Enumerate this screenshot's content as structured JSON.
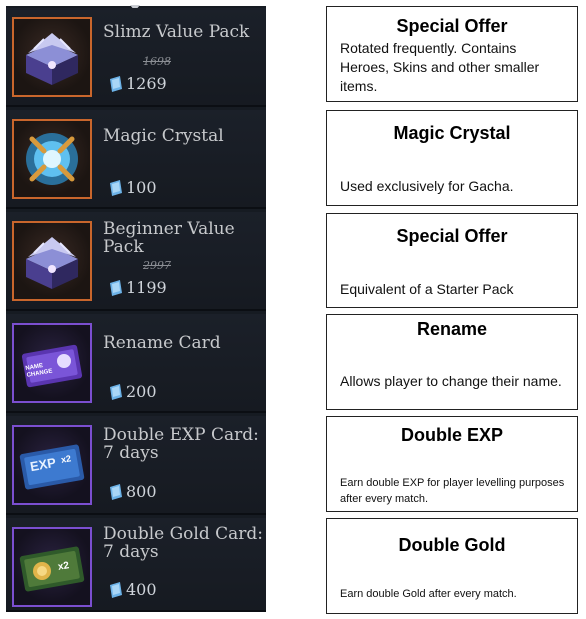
{
  "shop": {
    "items": [
      {
        "name": "Slimz Value Pack",
        "old_price": "1698",
        "price": "1269",
        "icon": "treasure-chest-icon",
        "frame": "orange"
      },
      {
        "name": "Magic Crystal",
        "old_price": "",
        "price": "100",
        "icon": "magic-crystal-icon",
        "frame": "orange"
      },
      {
        "name": "Beginner Value Pack",
        "old_price": "2997",
        "price": "1199",
        "icon": "treasure-chest-icon",
        "frame": "orange"
      },
      {
        "name": "Rename Card",
        "old_price": "",
        "price": "200",
        "icon": "rename-card-icon",
        "frame": "purple"
      },
      {
        "name": "Double EXP Card: 7 days",
        "old_price": "",
        "price": "800",
        "icon": "exp-card-icon",
        "frame": "purple"
      },
      {
        "name": "Double Gold Card: 7 days",
        "old_price": "",
        "price": "400",
        "icon": "gold-card-icon",
        "frame": "purple"
      }
    ],
    "exp_card_text": "EXP",
    "multiplier_text": "x2",
    "rename_card_text": "NAME CHANGE"
  },
  "descriptions": [
    {
      "title": "Special Offer",
      "text": "Rotated frequently. Contains Heroes, Skins and other smaller items."
    },
    {
      "title": "Magic Crystal",
      "text": "Used exclusively for Gacha."
    },
    {
      "title": "Special Offer",
      "text": "Equivalent of a Starter Pack"
    },
    {
      "title": "Rename",
      "text": "Allows player to change their name."
    },
    {
      "title": "Double EXP",
      "text": "Earn double EXP for player levelling purposes after every match."
    },
    {
      "title": "Double Gold",
      "text": "Earn double Gold after every match."
    }
  ],
  "colors": {
    "orange_frame": "#c9662c",
    "purple_frame": "#7b4fd0",
    "gem": "#6db3e8"
  }
}
